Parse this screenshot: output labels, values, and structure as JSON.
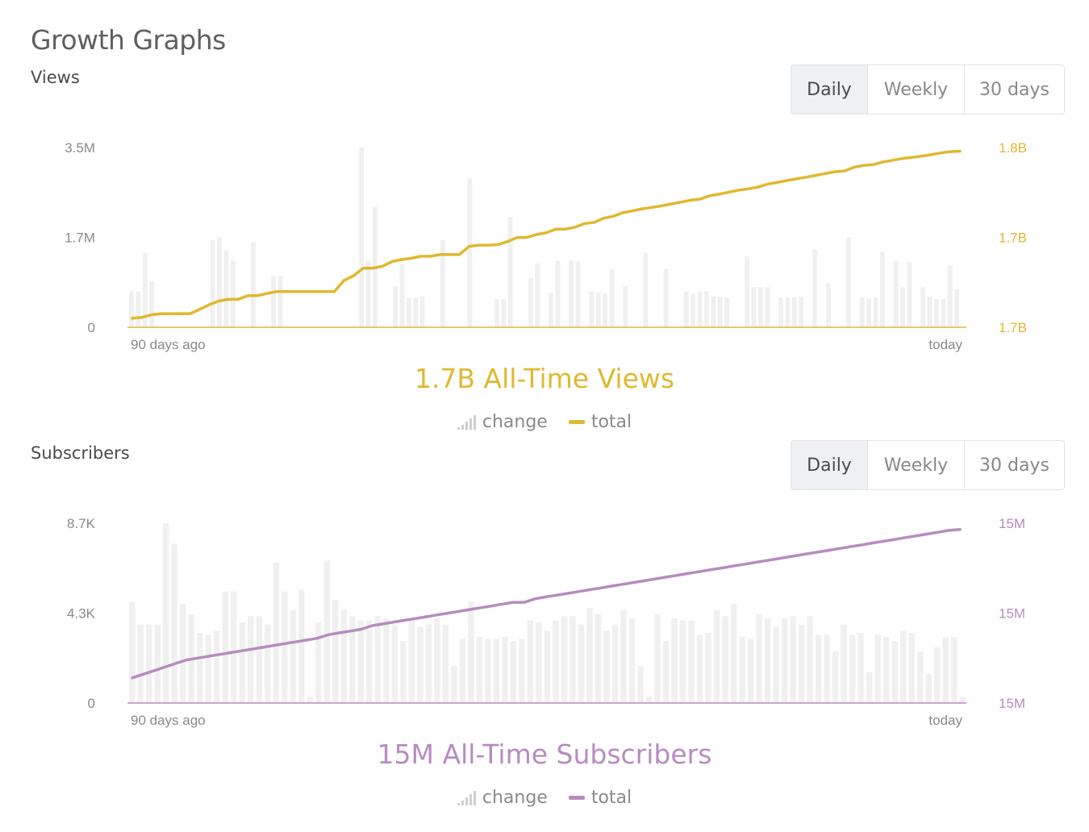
{
  "page_title": "Growth Graphs",
  "colors": {
    "views_accent": "#e0b82f",
    "subs_accent": "#b88bc0",
    "bar_color": "#f0f0f0"
  },
  "range_options": [
    "Daily",
    "Weekly",
    "30 days"
  ],
  "legend": {
    "change": "change",
    "total": "total"
  },
  "views": {
    "label": "Views",
    "selected_range": "Daily",
    "total_text": "1.7B All-Time Views",
    "icons": {
      "change": "bar-chart-icon",
      "total": "line-icon"
    }
  },
  "subscribers": {
    "label": "Subscribers",
    "selected_range": "Daily",
    "total_text": "15M All-Time Subscribers",
    "icons": {
      "change": "bar-chart-icon",
      "total": "line-icon"
    }
  },
  "chart_data": [
    {
      "type": "bar+line",
      "title": "Views",
      "x_labels": [
        "90 days ago",
        "today"
      ],
      "left_axis": {
        "ticks": [
          "3.5M",
          "1.7M",
          "0"
        ],
        "ylim": [
          0,
          3500000
        ]
      },
      "right_axis": {
        "ticks": [
          "1.8B",
          "1.7B",
          "1.7B"
        ],
        "ylim": [
          0,
          100
        ]
      },
      "series": [
        {
          "name": "change",
          "kind": "bar",
          "values": [
            700000,
            700000,
            1450000,
            900000,
            0,
            0,
            0,
            0,
            0,
            0,
            0,
            0,
            1700000,
            1760000,
            1500000,
            1300000,
            0,
            0,
            1660000,
            0,
            0,
            1000000,
            1000000,
            0,
            0,
            0,
            0,
            0,
            0,
            0,
            0,
            0,
            0,
            0,
            3500000,
            1300000,
            2350000,
            0,
            0,
            800000,
            1250000,
            580000,
            570000,
            600000,
            0,
            0,
            1700000,
            0,
            0,
            0,
            2900000,
            0,
            0,
            0,
            550000,
            550000,
            2150000,
            0,
            0,
            960000,
            1250000,
            0,
            670000,
            1300000,
            0,
            1300000,
            1280000,
            0,
            700000,
            680000,
            660000,
            1130000,
            0,
            800000,
            0,
            0,
            1450000,
            0,
            0,
            1140000,
            0,
            0,
            700000,
            650000,
            700000,
            700000,
            600000,
            590000,
            580000,
            0,
            0,
            1380000,
            780000,
            780000,
            780000,
            0,
            580000,
            580000,
            580000,
            600000,
            0,
            1520000,
            0,
            860000,
            0,
            0,
            1760000,
            0,
            580000,
            560000,
            580000,
            1460000,
            0,
            1300000,
            780000,
            1270000,
            0,
            780000,
            600000,
            550000,
            550000,
            1200000,
            750000,
            0
          ]
        },
        {
          "name": "total",
          "kind": "line",
          "values": [
            5,
            5.5,
            7,
            7.6,
            7.6,
            7.6,
            7.6,
            10,
            12.6,
            14.6,
            15.6,
            15.6,
            17.6,
            17.6,
            18.8,
            19.9,
            19.9,
            19.9,
            19.9,
            19.9,
            19.9,
            19.9,
            26.1,
            28.7,
            32.9,
            32.9,
            34,
            36.6,
            37.7,
            38.4,
            39.5,
            39.5,
            40.5,
            40.5,
            40.5,
            45,
            45.7,
            45.7,
            46,
            47.7,
            50,
            50,
            51.6,
            52.6,
            54.6,
            54.6,
            55.7,
            57.7,
            58.4,
            60.7,
            61.8,
            63.8,
            64.8,
            65.9,
            66.7,
            67.6,
            68.6,
            69.6,
            70.7,
            71.3,
            73.2,
            74.1,
            75.2,
            76.3,
            77,
            78,
            79.6,
            80.6,
            81.6,
            82.6,
            83.5,
            84.5,
            85.5,
            86.5,
            87,
            89,
            90.1,
            90.5,
            92,
            92.9,
            93.9,
            94.5,
            95.2,
            96,
            97,
            97.7,
            98
          ]
        }
      ]
    },
    {
      "type": "bar+line",
      "title": "Subscribers",
      "x_labels": [
        "90 days ago",
        "today"
      ],
      "left_axis": {
        "ticks": [
          "8.7K",
          "4.3K",
          "0"
        ],
        "ylim": [
          0,
          8700
        ]
      },
      "right_axis": {
        "ticks": [
          "15M",
          "15M",
          "15M"
        ],
        "ylim": [
          0,
          100
        ]
      },
      "series": [
        {
          "name": "change",
          "kind": "bar",
          "values": [
            4900,
            3800,
            3800,
            3800,
            8700,
            7700,
            4800,
            4300,
            3400,
            3300,
            3500,
            5400,
            5400,
            3900,
            4200,
            4200,
            3800,
            6800,
            5400,
            4500,
            5500,
            300,
            3900,
            6900,
            5000,
            4500,
            4200,
            4000,
            4000,
            4200,
            4100,
            3800,
            3000,
            4000,
            3700,
            3800,
            4100,
            3800,
            1800,
            3100,
            4900,
            3200,
            3100,
            3100,
            3200,
            3000,
            3100,
            4000,
            3900,
            3500,
            4000,
            4200,
            4200,
            3800,
            4600,
            4300,
            3500,
            3800,
            4500,
            4100,
            1800,
            300,
            4300,
            3000,
            4100,
            4000,
            4000,
            3300,
            3400,
            4500,
            4200,
            4800,
            3200,
            3100,
            4300,
            4100,
            3700,
            4100,
            4200,
            3800,
            4200,
            3300,
            3300,
            2500,
            3800,
            3300,
            3400,
            1500,
            3300,
            3200,
            3000,
            3500,
            3400,
            2500,
            1400,
            2700,
            3200,
            3200,
            300
          ]
        },
        {
          "name": "total",
          "kind": "line",
          "values": [
            14,
            16,
            18,
            20,
            22,
            24,
            25,
            26,
            27,
            28,
            29,
            30,
            31,
            32,
            33,
            34,
            35,
            36,
            38,
            39,
            40,
            41,
            43,
            44,
            45,
            46,
            47,
            48,
            49,
            50,
            51,
            52,
            53,
            54,
            55,
            56,
            56,
            58,
            59,
            60,
            61,
            62,
            63,
            64,
            65,
            66,
            67,
            68,
            69,
            70,
            71,
            72,
            73,
            74,
            75,
            76,
            77,
            78,
            79,
            80,
            81,
            82,
            83,
            84,
            85,
            86,
            87,
            88,
            89,
            90,
            91,
            92,
            93,
            94,
            95,
            96,
            96.5
          ]
        }
      ]
    }
  ]
}
